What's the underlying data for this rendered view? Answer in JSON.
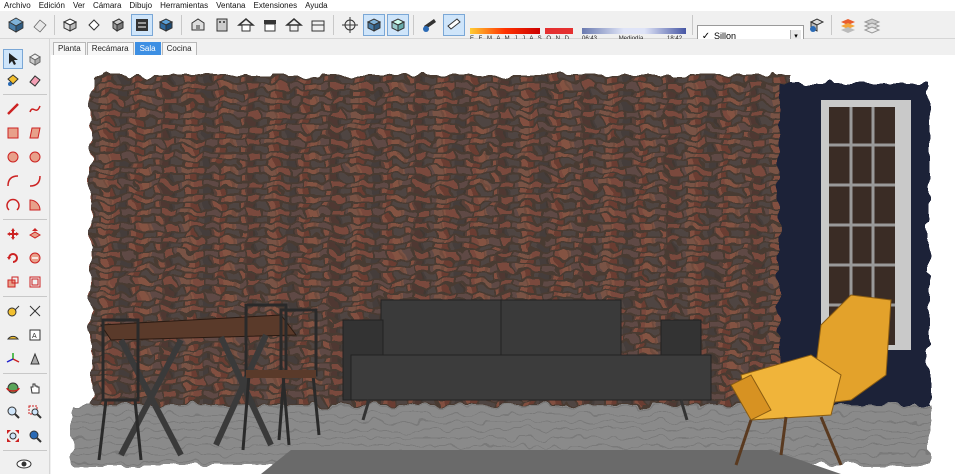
{
  "menu": [
    "Archivo",
    "Edición",
    "Ver",
    "Cámara",
    "Dibujo",
    "Herramientas",
    "Ventana",
    "Extensiones",
    "Ayuda"
  ],
  "toolbar_icons": [
    "box-icon",
    "box-outline-icon",
    "iso-view-icon",
    "top-view-icon",
    "front-view-icon",
    "right-view-icon",
    "back-view-icon",
    "left-view-icon",
    "xray-icon",
    "wireframe-icon",
    "hidden-line-icon",
    "shaded-icon",
    "textured-icon",
    "monochrome-icon"
  ],
  "shadows": {
    "months": "E F M A M J J A S O N D",
    "time_start": "06:43",
    "time_mid": "Mediodía",
    "time_end": "18:42"
  },
  "scene_select": {
    "value": "Sillon"
  },
  "tabs": [
    {
      "label": "Planta",
      "active": false
    },
    {
      "label": "Recámara",
      "active": false
    },
    {
      "label": "Sala",
      "active": true
    },
    {
      "label": "Cocina",
      "active": false
    }
  ],
  "colors": {
    "brick": "#6e4a3c",
    "navy_wall": "#1a2438",
    "sofa": "#3c3c3c",
    "chair": "#e3a22b",
    "active_tab": "#3d8fe3"
  }
}
